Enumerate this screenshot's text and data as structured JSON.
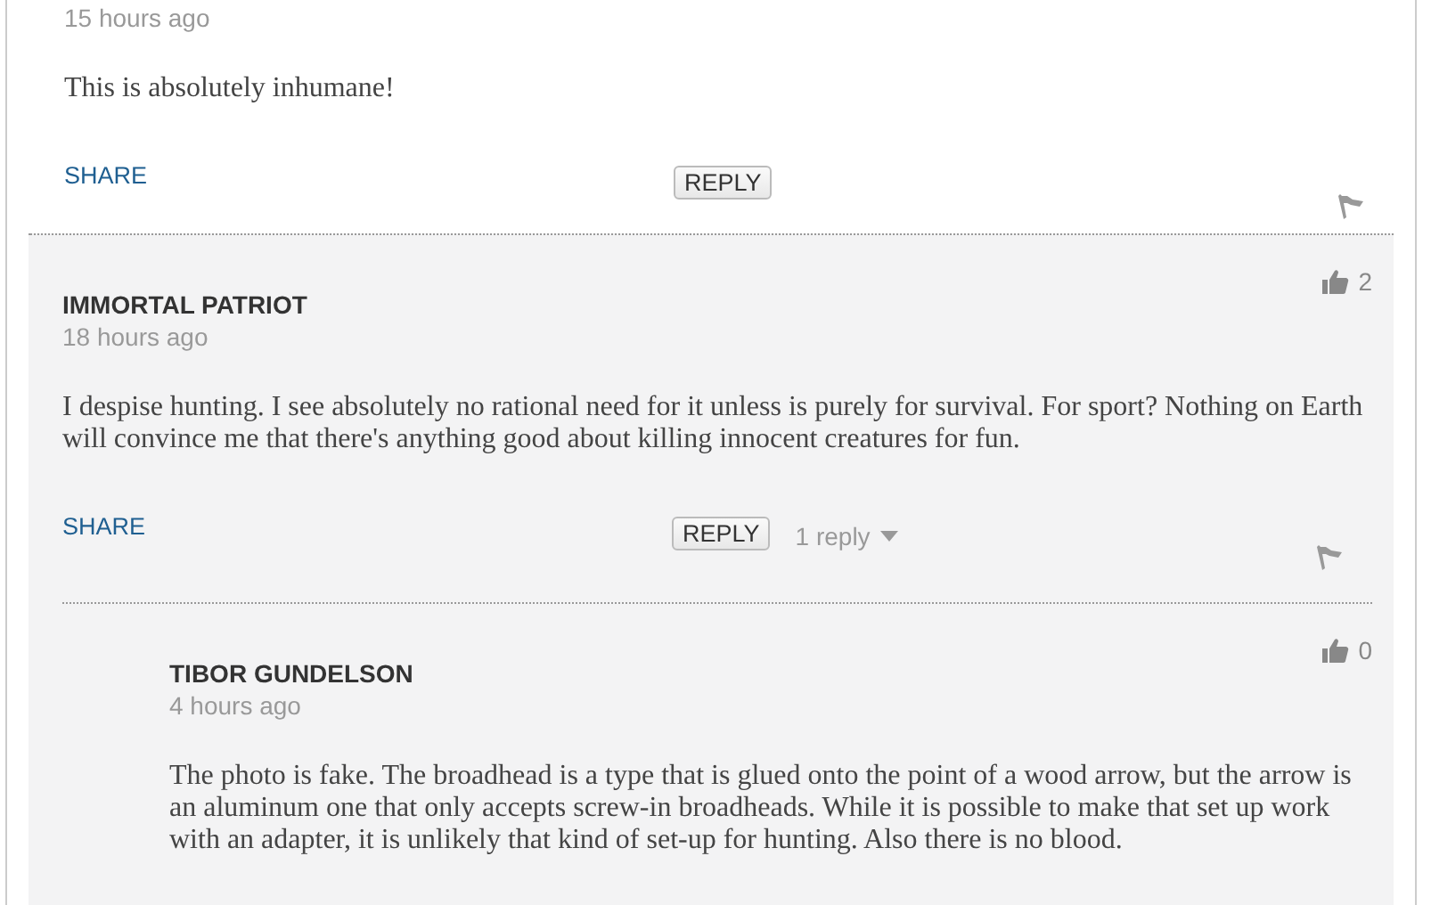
{
  "comments": [
    {
      "time": "15 hours ago",
      "body": "This is absolutely inhumane!",
      "share": "SHARE",
      "reply_button": "REPLY"
    },
    {
      "author": "IMMORTAL PATRIOT",
      "time": "18 hours ago",
      "likes": "2",
      "body": "I despise hunting. I see absolutely no rational need for it unless is purely for survival. For sport? Nothing on Earth will convince me that there's anything good about killing innocent creatures for fun.",
      "share": "SHARE",
      "reply_button": "REPLY",
      "replies_label": "1 reply",
      "children": [
        {
          "author": "TIBOR GUNDELSON",
          "time": "4 hours ago",
          "likes": "0",
          "body": "The photo is fake. The broadhead is a type that is glued onto the point of a wood arrow, but the arrow is an aluminum one that only accepts screw-in broadheads. While it is possible to make that set up work with an adapter, it is unlikely that kind of set-up for hunting. Also there is no blood."
        }
      ]
    }
  ]
}
